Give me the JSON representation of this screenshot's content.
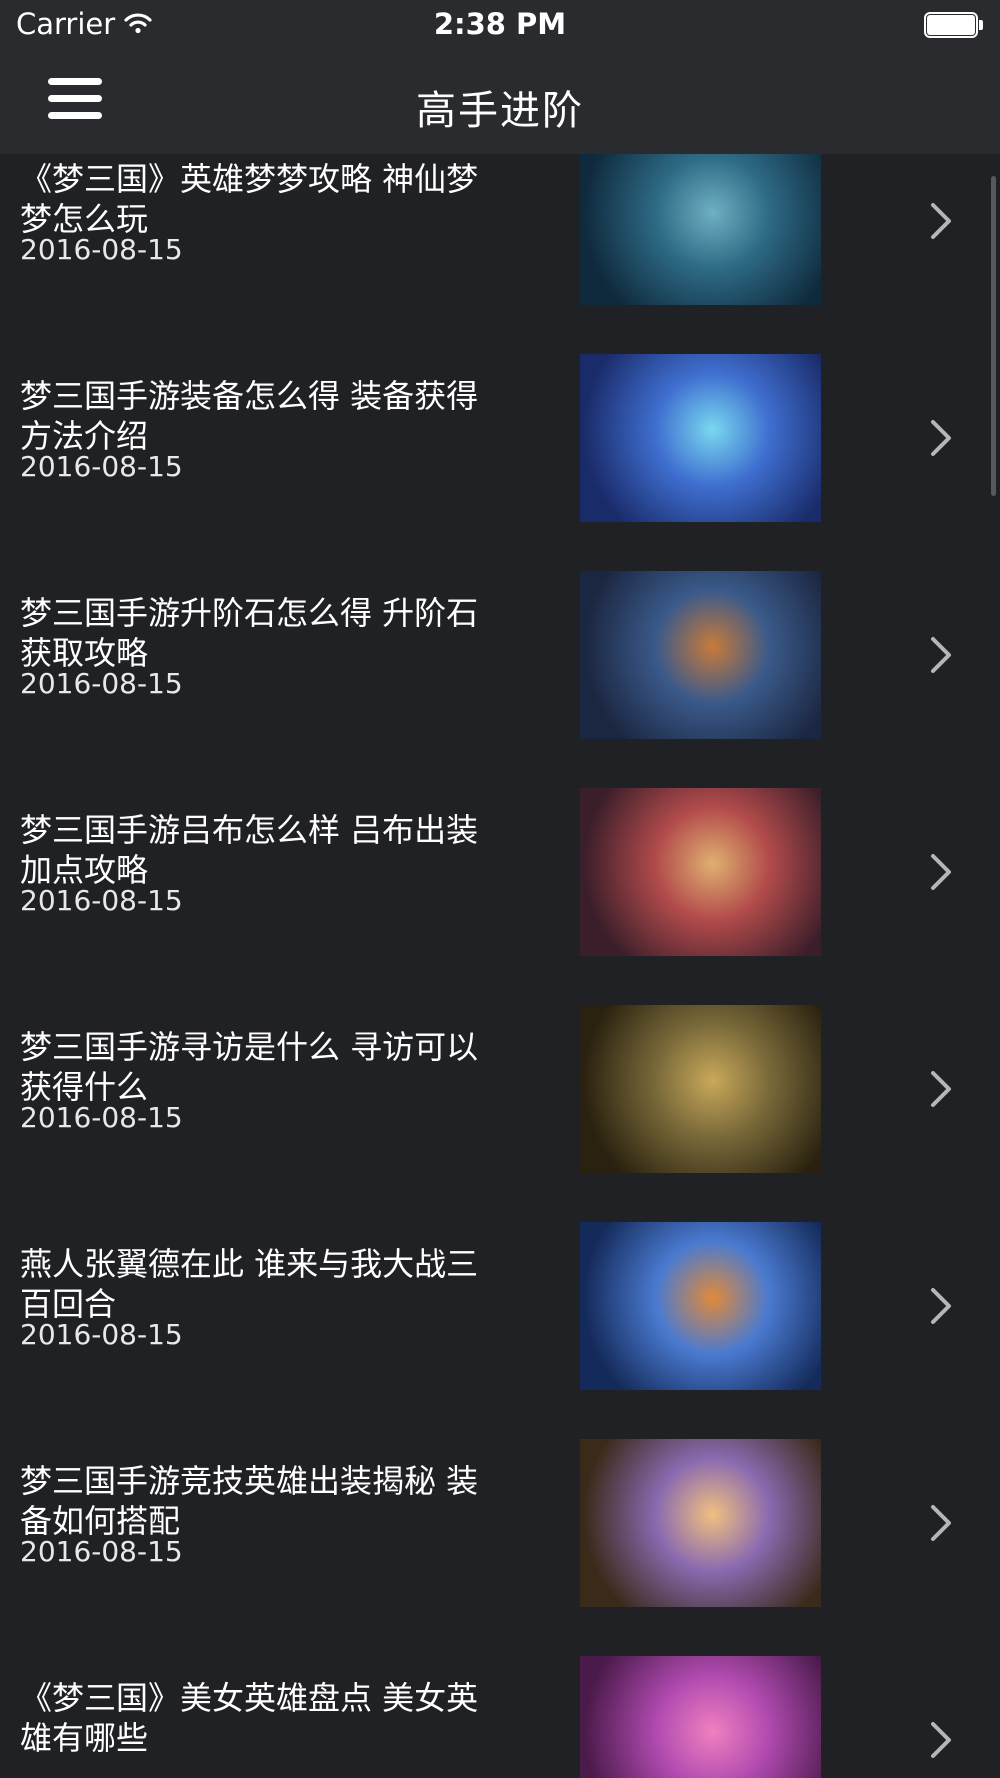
{
  "status_bar": {
    "carrier": "Carrier",
    "time": "2:38 PM",
    "battery_level": 1.0
  },
  "nav": {
    "title": "高手进阶",
    "menu_icon": "hamburger-menu-icon"
  },
  "articles": [
    {
      "title": "《梦三国》英雄梦梦攻略 神仙梦梦怎么玩",
      "date": "2016-08-15",
      "thumb_colors": [
        "#0f2a3c",
        "#2e6a86",
        "#6fb0c2"
      ]
    },
    {
      "title": "梦三国手游装备怎么得 装备获得方法介绍",
      "date": "2016-08-15",
      "thumb_colors": [
        "#1a2b6a",
        "#3f6fd0",
        "#79d8f0"
      ]
    },
    {
      "title": "梦三国手游升阶石怎么得 升阶石获取攻略",
      "date": "2016-08-15",
      "thumb_colors": [
        "#1b2640",
        "#3a5a8a",
        "#c97a3a"
      ]
    },
    {
      "title": "梦三国手游吕布怎么样 吕布出装加点攻略",
      "date": "2016-08-15",
      "thumb_colors": [
        "#3a1e2a",
        "#b24b4b",
        "#e0b070"
      ]
    },
    {
      "title": "梦三国手游寻访是什么 寻访可以获得什么",
      "date": "2016-08-15",
      "thumb_colors": [
        "#2a2210",
        "#7a6a3a",
        "#c9a85a"
      ]
    },
    {
      "title": "燕人张翼德在此 谁来与我大战三百回合",
      "date": "2016-08-15",
      "thumb_colors": [
        "#142a5a",
        "#4a7ad0",
        "#e08a3a"
      ]
    },
    {
      "title": "梦三国手游竞技英雄出装揭秘 装备如何搭配",
      "date": "2016-08-15",
      "thumb_colors": [
        "#3a2a1a",
        "#8a6ab0",
        "#f0c080"
      ]
    },
    {
      "title": "《梦三国》美女英雄盘点 美女英雄有哪些",
      "date": "",
      "thumb_colors": [
        "#4a1a4a",
        "#b04ab0",
        "#f080c0"
      ]
    }
  ]
}
